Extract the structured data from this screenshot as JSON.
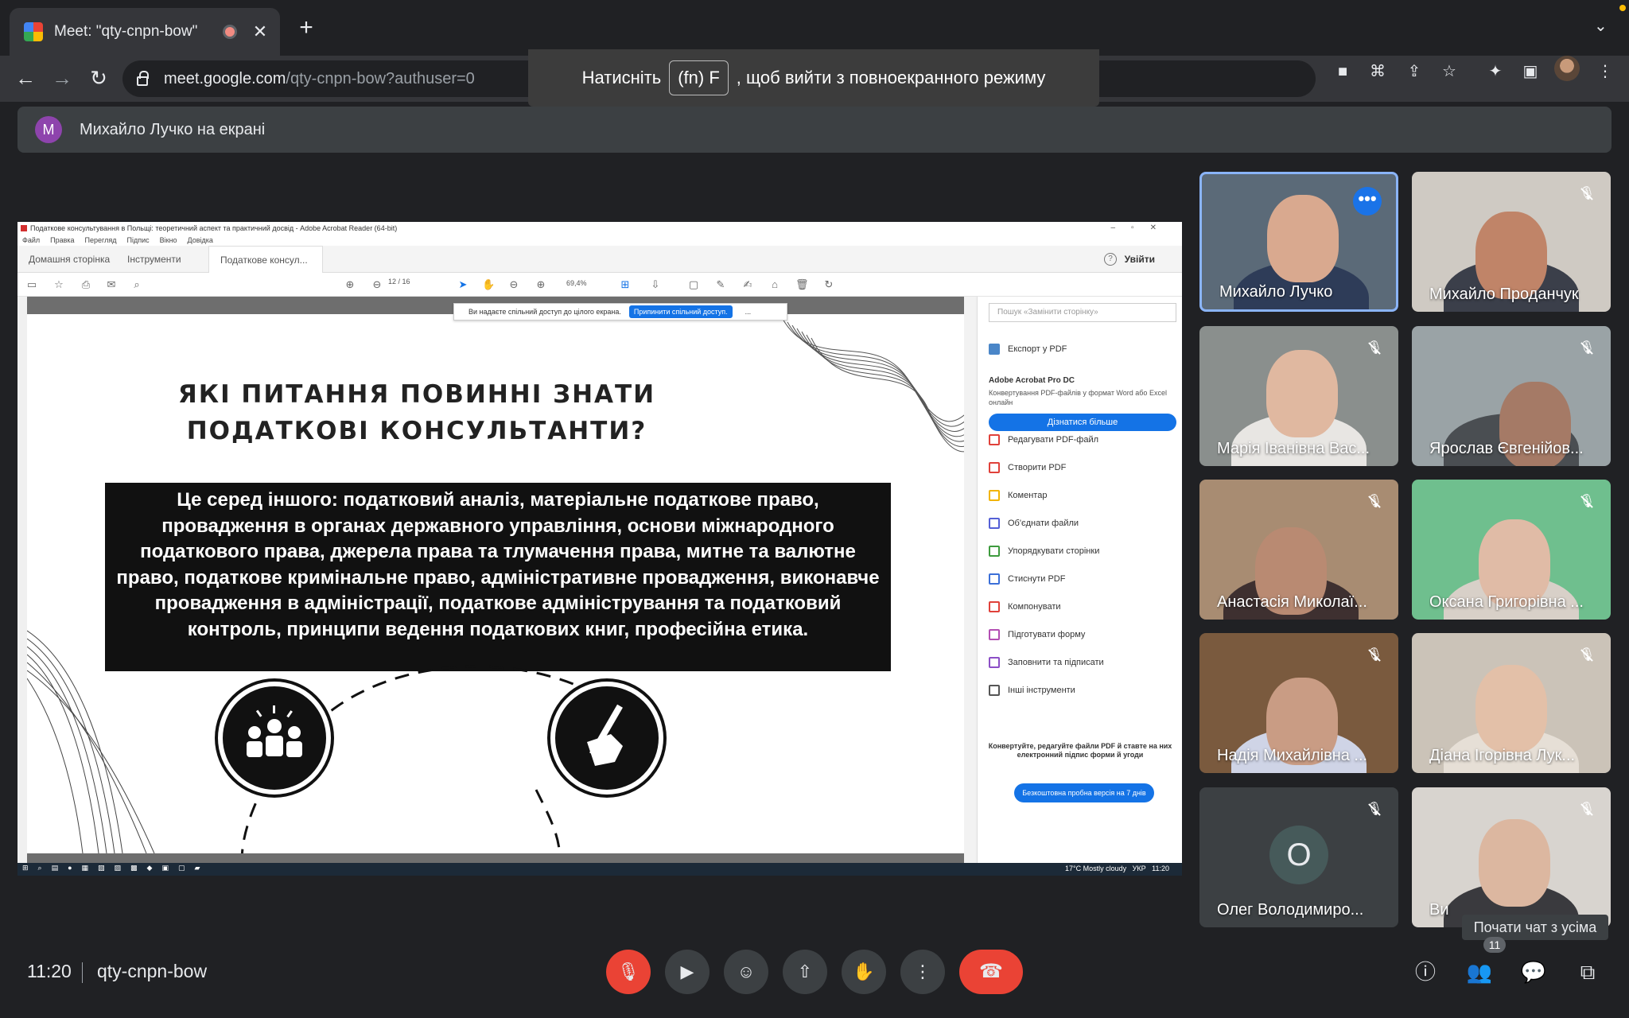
{
  "browser": {
    "tab_title": "Meet: \"qty-cnpn-bow\"",
    "url_host": "meet.google.com",
    "url_path": "/qty-cnpn-bow?authuser=0",
    "fullscreen_hint_prefix": "Натисніть",
    "fullscreen_hint_key": "(fn) F",
    "fullscreen_hint_suffix": ", щоб вийти з повноекранного режиму"
  },
  "banner": {
    "avatar_initial": "M",
    "text": "Михайло Лучко на екрані"
  },
  "shared_screen": {
    "window_title": "Податкове консультування в Польщі: теоретичний аспект та практичний досвід - Adobe Acrobat Reader (64-bit)",
    "menu": [
      "Файл",
      "Правка",
      "Перегляд",
      "Підпис",
      "Вікно",
      "Довідка"
    ],
    "tabs": [
      "Домашня сторінка",
      "Інструменти",
      "Податкове консул..."
    ],
    "sign_in": "Увійти",
    "page_current": "12",
    "page_total": "/ 16",
    "zoom": "69,4%",
    "share_notice": "Ви надаєте спільний доступ до цілого екрана.",
    "share_stop": "Припинити спільний доступ.",
    "share_more": "...",
    "slide_title": "ЯКІ ПИТАННЯ ПОВИННІ ЗНАТИ ПОДАТКОВІ КОНСУЛЬТАНТИ?",
    "slide_body": "Це серед іншого: податковий аналіз, матеріальне податкове право, провадження в органах державного управління, основи міжнародного податкового права, джерела права та тлумачення права, митне та валютне право, податкове кримінальне право, адміністративне провадження, виконавче провадження в адміністрації, податкове адміністрування та податковий контроль, принципи ведення податкових книг, професійна етика.",
    "pane": {
      "search_placeholder": "Пошук «Замінити сторінку»",
      "export": "Експорт у PDF",
      "pro_title": "Adobe Acrobat Pro DC",
      "pro_desc": "Конвертування PDF-файлів у формат Word або Excel онлайн",
      "learn_more": "Дізнатися більше",
      "items": [
        "Редагувати PDF-файл",
        "Створити PDF",
        "Коментар",
        "Об'єднати файли",
        "Упорядкувати сторінки",
        "Стиснути PDF",
        "Компонувати",
        "Підготувати форму",
        "Заповнити та підписати",
        "Інші інструменти"
      ],
      "item_colors": [
        "#e0413a",
        "#e0413a",
        "#f2b400",
        "#5560d6",
        "#3e9b3e",
        "#3b6fd8",
        "#e0413a",
        "#b34fb3",
        "#8c4fc6",
        "#555555"
      ],
      "promo": "Конвертуйте, редагуйте файли PDF й ставте на них електронний підпис форми й угоди",
      "trial": "Безкоштовна пробна версія на 7 днів"
    },
    "taskbar": {
      "weather": "17°C  Mostly cloudy",
      "lang": "УКР",
      "time": "11:20"
    }
  },
  "participants": [
    {
      "name": "Михайло Лучко",
      "muted": false
    },
    {
      "name": "Михайло Проданчук",
      "muted": true
    },
    {
      "name": "Марія Іванівна Вас...",
      "muted": true
    },
    {
      "name": "Ярослав Євгенійов...",
      "muted": true
    },
    {
      "name": "Анастасія Миколаї...",
      "muted": true
    },
    {
      "name": "Оксана Григорівна ...",
      "muted": true
    },
    {
      "name": "Надія Михайлівна ...",
      "muted": true
    },
    {
      "name": "Діана Ігорівна Лук...",
      "muted": true
    },
    {
      "name": "Олег Володимиро...",
      "muted": true,
      "initial": "О"
    },
    {
      "name": "Ви",
      "muted": true
    }
  ],
  "chat_tooltip": "Почати чат з усіма",
  "meeting": {
    "time": "11:20",
    "code": "qty-cnpn-bow",
    "people_count": "11"
  },
  "colors": {
    "background": "#202124",
    "leave_red": "#ea4335",
    "active_speaker_border": "#8ab4f8",
    "acrobat_blue": "#1473e6"
  }
}
